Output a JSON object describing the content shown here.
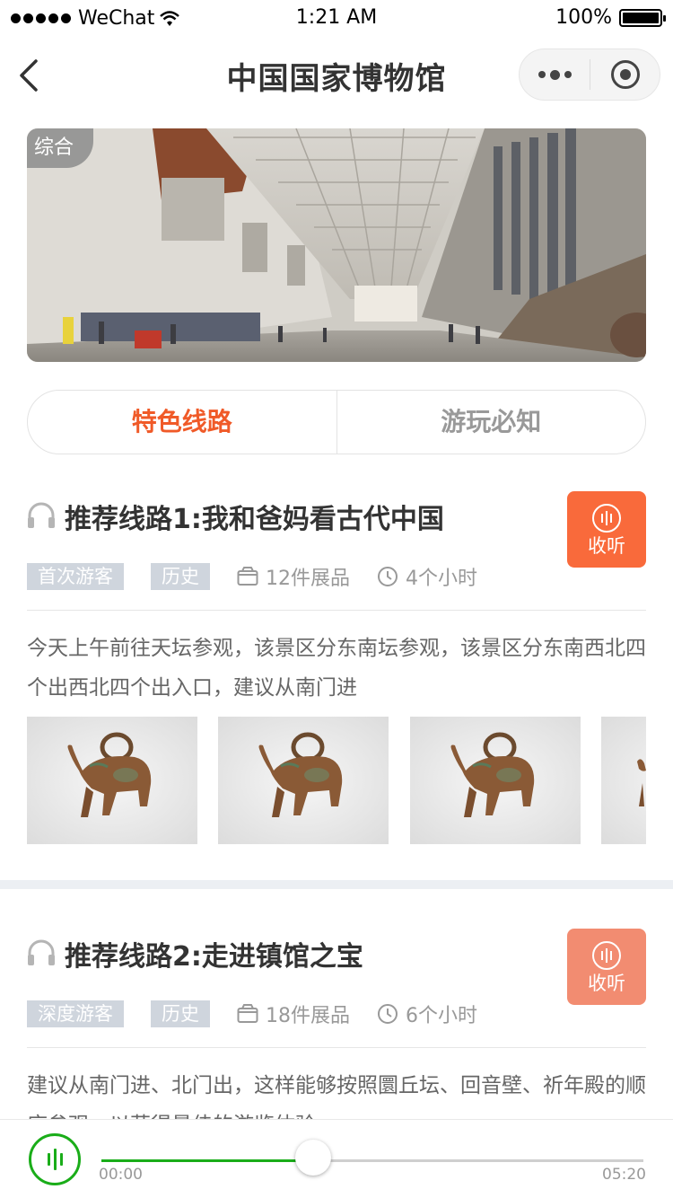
{
  "status_bar": {
    "carrier": "WeChat",
    "time": "1:21 AM",
    "battery": "100%"
  },
  "nav": {
    "title": "中国国家博物馆",
    "back_icon": "chevron-left-icon",
    "more_icon": "more-dots-icon",
    "close_icon": "target-close-icon"
  },
  "banner": {
    "tag": "综合"
  },
  "tabs": [
    {
      "label": "特色线路",
      "active": true
    },
    {
      "label": "游玩必知",
      "active": false
    }
  ],
  "routes": [
    {
      "title": "推荐线路1:我和爸妈看古代中国",
      "tags": [
        "首次游客",
        "历史"
      ],
      "exhibits": "12件展品",
      "duration": "4个小时",
      "listen_label": "收听",
      "description": "今天上午前往天坛参观，该景区分东南坛参观，该景区分东南西北四个出西北四个出入口，建议从南门进",
      "button_color": "#f96a3b"
    },
    {
      "title": "推荐线路2:走进镇馆之宝",
      "tags": [
        "深度游客",
        "历史"
      ],
      "exhibits": "18件展品",
      "duration": "6个小时",
      "listen_label": "收听",
      "description": "建议从南门进、北门出，这样能够按照圜丘坛、回音壁、祈年殿的顺序参观，以获得最佳的游览体验。",
      "button_color": "#f28c71"
    }
  ],
  "player": {
    "current_time": "00:00",
    "total_time": "05:20",
    "progress": 0.39,
    "accent": "#1aad19"
  },
  "colors": {
    "accent_orange": "#f05a28",
    "tag_bg": "#cfd5dd"
  }
}
